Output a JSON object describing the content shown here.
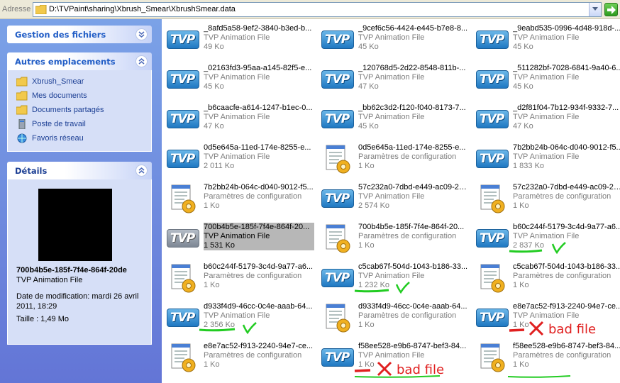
{
  "address": {
    "label": "Adresse",
    "path": "D:\\TVPaint\\sharing\\Xbrush_Smear\\XbrushSmear.data"
  },
  "sidebar": {
    "file_tasks": {
      "title": "Gestion des fichiers"
    },
    "other_places": {
      "title": "Autres emplacements",
      "items": [
        {
          "label": "Xbrush_Smear",
          "icon": "folder-icon"
        },
        {
          "label": "Mes documents",
          "icon": "folder-icon"
        },
        {
          "label": "Documents partagés",
          "icon": "folder-icon"
        },
        {
          "label": "Poste de travail",
          "icon": "computer-icon"
        },
        {
          "label": "Favoris réseau",
          "icon": "network-icon"
        }
      ]
    },
    "details": {
      "title": "Détails",
      "name": "700b4b5e-185f-7f4e-864f-20de",
      "type": "TVP Animation File",
      "date": "Date de modification: mardi 26 avril 2011, 18:29",
      "size": "Taille : 1,49 Mo"
    }
  },
  "files": [
    {
      "name": "_8afd5a58-9ef2-3840-b3ed-b...",
      "type": "TVP Animation File",
      "size": "49 Ko",
      "icon": "tvp"
    },
    {
      "name": "_9cef6c56-4424-e445-b7e8-8...",
      "type": "TVP Animation File",
      "size": "45 Ko",
      "icon": "tvp"
    },
    {
      "name": "_9eabd535-0996-4d48-918d-...",
      "type": "TVP Animation File",
      "size": "45 Ko",
      "icon": "tvp"
    },
    {
      "name": "_02163fd3-95aa-a145-82f5-e...",
      "type": "TVP Animation File",
      "size": "45 Ko",
      "icon": "tvp"
    },
    {
      "name": "_120768d5-2d22-8548-811b-...",
      "type": "TVP Animation File",
      "size": "47 Ko",
      "icon": "tvp"
    },
    {
      "name": "_511282bf-7028-6841-9a40-6...",
      "type": "TVP Animation File",
      "size": "45 Ko",
      "icon": "tvp"
    },
    {
      "name": "_b6caacfe-a614-1247-b1ec-0...",
      "type": "TVP Animation File",
      "size": "47 Ko",
      "icon": "tvp"
    },
    {
      "name": "_bb62c3d2-f120-f040-8173-7...",
      "type": "TVP Animation File",
      "size": "45 Ko",
      "icon": "tvp"
    },
    {
      "name": "_d2f81f04-7b12-934f-9332-7...",
      "type": "TVP Animation File",
      "size": "47 Ko",
      "icon": "tvp"
    },
    {
      "name": "0d5e645a-11ed-174e-8255-e...",
      "type": "TVP Animation File",
      "size": "2 011 Ko",
      "icon": "tvp"
    },
    {
      "name": "0d5e645a-11ed-174e-8255-e...",
      "type": "Paramètres de configuration",
      "size": "1 Ko",
      "icon": "config"
    },
    {
      "name": "7b2bb24b-064c-d040-9012-f5...",
      "type": "TVP Animation File",
      "size": "1 833 Ko",
      "icon": "tvp"
    },
    {
      "name": "7b2bb24b-064c-d040-9012-f5...",
      "type": "Paramètres de configuration",
      "size": "1 Ko",
      "icon": "config"
    },
    {
      "name": "57c232a0-7dbd-e449-ac09-2d...",
      "type": "TVP Animation File",
      "size": "2 574 Ko",
      "icon": "tvp"
    },
    {
      "name": "57c232a0-7dbd-e449-ac09-2d...",
      "type": "Paramètres de configuration",
      "size": "1 Ko",
      "icon": "config"
    },
    {
      "name": "700b4b5e-185f-7f4e-864f-20...",
      "type": "TVP Animation File",
      "size": "1 531 Ko",
      "icon": "tvp",
      "selected": true
    },
    {
      "name": "700b4b5e-185f-7f4e-864f-20...",
      "type": "Paramètres de configuration",
      "size": "1 Ko",
      "icon": "config"
    },
    {
      "name": "b60c244f-5179-3c4d-9a77-a6...",
      "type": "TVP Animation File",
      "size": "2 837 Ko",
      "icon": "tvp"
    },
    {
      "name": "b60c244f-5179-3c4d-9a77-a6...",
      "type": "Paramètres de configuration",
      "size": "1 Ko",
      "icon": "config"
    },
    {
      "name": "c5cab67f-504d-1043-b186-33...",
      "type": "TVP Animation File",
      "size": "1 232 Ko",
      "icon": "tvp"
    },
    {
      "name": "c5cab67f-504d-1043-b186-33...",
      "type": "Paramètres de configuration",
      "size": "1 Ko",
      "icon": "config"
    },
    {
      "name": "d933f4d9-46cc-0c4e-aaab-64...",
      "type": "TVP Animation File",
      "size": "2 356 Ko",
      "icon": "tvp"
    },
    {
      "name": "d933f4d9-46cc-0c4e-aaab-64...",
      "type": "Paramètres de configuration",
      "size": "1 Ko",
      "icon": "config"
    },
    {
      "name": "e8e7ac52-f913-2240-94e7-ce...",
      "type": "TVP Animation File",
      "size": "1 Ko",
      "icon": "tvp"
    },
    {
      "name": "e8e7ac52-f913-2240-94e7-ce...",
      "type": "Paramètres de configuration",
      "size": "1 Ko",
      "icon": "config"
    },
    {
      "name": "f58ee528-e9b6-8747-bef3-84...",
      "type": "TVP Animation File",
      "size": "1 Ko",
      "icon": "tvp"
    },
    {
      "name": "f58ee528-e9b6-8747-bef3-84...",
      "type": "Paramètres de configuration",
      "size": "1 Ko",
      "icon": "config"
    }
  ],
  "annotations": {
    "bad_file_label": "bad file",
    "icon_label": "TVP",
    "good_color": "#22cc22",
    "bad_color": "#e02020"
  }
}
